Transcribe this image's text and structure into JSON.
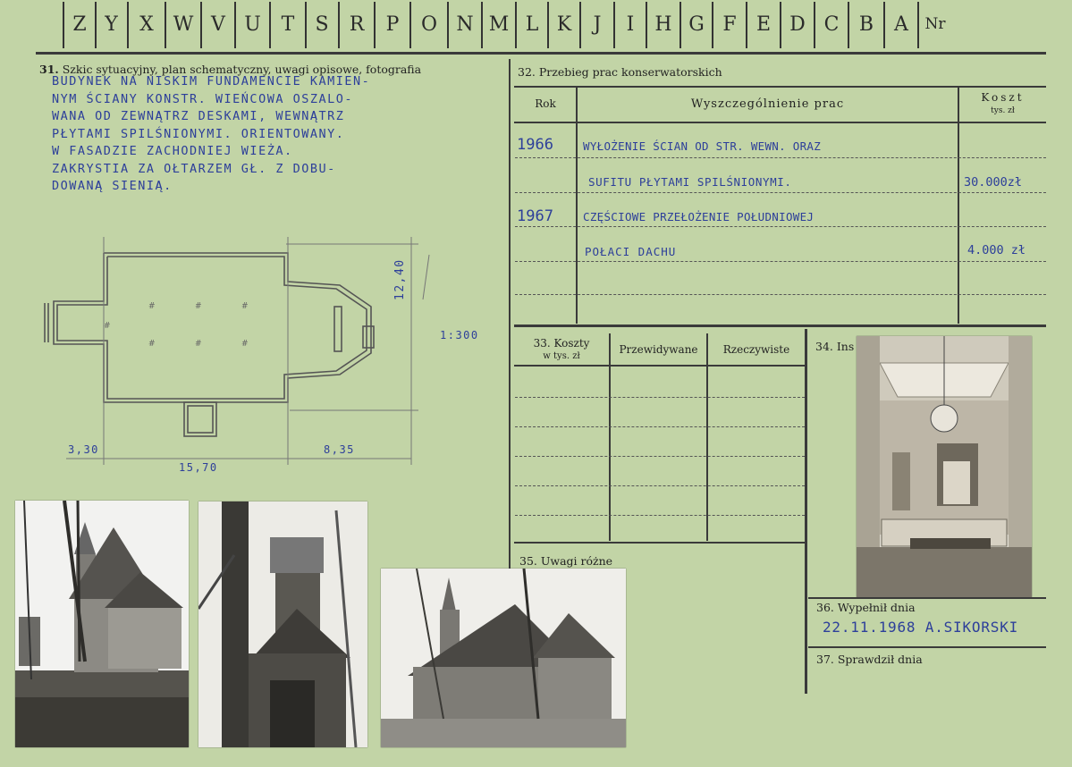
{
  "strip": {
    "letters": [
      "Z",
      "Y",
      "X",
      "W",
      "V",
      "U",
      "T",
      "S",
      "R",
      "P",
      "O",
      "N",
      "M",
      "L",
      "K",
      "J",
      "I",
      "H",
      "G",
      "F",
      "E",
      "D",
      "C",
      "B",
      "A"
    ],
    "nr_label": "Nr"
  },
  "section31": {
    "number": "31.",
    "title": "Szkic sytuacyjny, plan schematyczny, uwagi opisowe, fotografia",
    "notes": [
      "BUDYNEK NA NISKIM FUNDAMENCIE KAMIEN-",
      "NYM ŚCIANY KONSTR. WIEŃCOWA OSZALO-",
      "WANA OD ZEWNĄTRZ DESKAMI, WEWNĄTRZ",
      "PŁYTAMI SPILŚNIONYMI. ORIENTOWANY.",
      "W FASADZIE ZACHODNIEJ WIEŻA.",
      "ZAKRYSTIA ZA OŁTARZEM GŁ. Z DOBU-",
      "DOWANĄ SIENIĄ."
    ],
    "plan": {
      "dim_height": "12,40",
      "scale": "1:300",
      "dim_left": "3,30",
      "dim_right": "8,35",
      "dim_total": "15,70"
    }
  },
  "section32": {
    "number": "32.",
    "title": "Przebieg prac konserwatorskich",
    "col_year": "Rok",
    "col_desc": "Wyszczególnienie prac",
    "col_cost": "Koszt",
    "col_cost_unit": "tys. zł",
    "rows": [
      {
        "year": "1966",
        "desc": "WYŁOŻENIE ŚCIAN OD STR. WEWN. ORAZ",
        "cost": ""
      },
      {
        "year": "",
        "desc": "SUFITU PŁYTAMI SPILŚNIONYMI.",
        "cost": "30.000zł"
      },
      {
        "year": "1967",
        "desc": "CZĘŚCIOWE PRZEŁOŻENIE POŁUDNIOWEJ",
        "cost": ""
      },
      {
        "year": "",
        "desc": "POŁACI DACHU",
        "cost": "4.000 zł"
      }
    ]
  },
  "section33": {
    "number": "33.",
    "title": "Koszty",
    "unit": "w tys. zł",
    "col_planned": "Przewidywane",
    "col_actual": "Rzeczywiste"
  },
  "section34": {
    "label": "34. Ins"
  },
  "section35": {
    "label": "35. Uwagi różne"
  },
  "section36": {
    "label": "36. Wypełnił dnia",
    "value": "22.11.1968 A.SIKORSKI"
  },
  "section37": {
    "label": "37. Sprawdził dnia"
  }
}
